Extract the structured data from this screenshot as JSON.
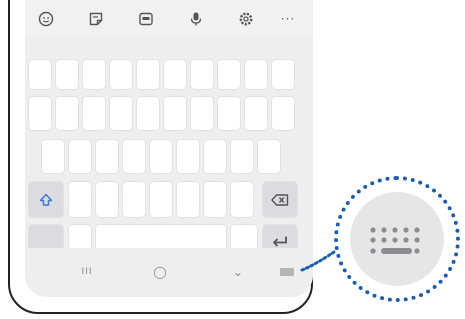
{
  "toolbar": {
    "icons": [
      "emoji-icon",
      "sticker-icon",
      "gif-icon",
      "microphone-icon",
      "settings-icon",
      "more-icon"
    ],
    "more_label": "···"
  },
  "navbar": {
    "recents_label": "III",
    "home_label": "◯",
    "back_label": "⌄"
  },
  "colors": {
    "accent": "#1a5faf",
    "keyboard_bg": "#eeeeef",
    "key": "#ffffff",
    "special_key": "#dcdcdf",
    "shift_icon": "#3a7bd5"
  }
}
